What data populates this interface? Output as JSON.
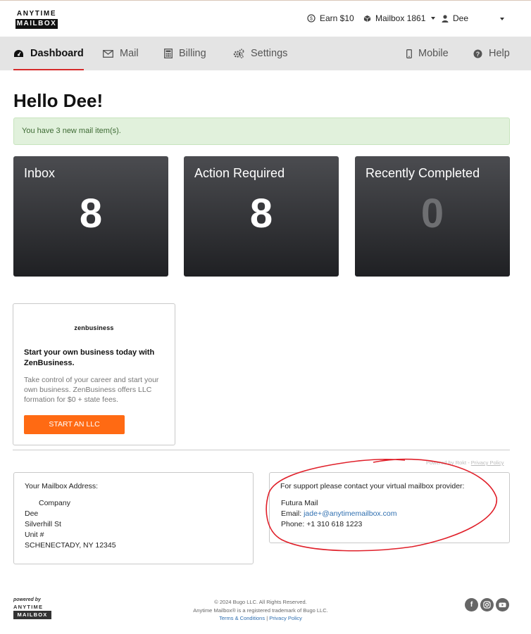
{
  "brand": {
    "line1": "ANYTIME",
    "line2": "MAILBOX"
  },
  "topbar": {
    "earn": "Earn $10",
    "mailbox": "Mailbox 1861",
    "user": "Dee"
  },
  "nav": {
    "dashboard": "Dashboard",
    "mail": "Mail",
    "billing": "Billing",
    "settings": "Settings",
    "mobile": "Mobile",
    "help": "Help"
  },
  "greeting": "Hello Dee!",
  "alert": "You have 3 new mail item(s).",
  "cards": [
    {
      "title": "Inbox",
      "count": "8"
    },
    {
      "title": "Action Required",
      "count": "8"
    },
    {
      "title": "Recently Completed",
      "count": "0"
    }
  ],
  "promo": {
    "brand": "zenbusiness",
    "headline": "Start your own business today with ZenBusiness.",
    "body": "Take control of your career and start your own business. ZenBusiness offers LLC formation for $0 + state fees.",
    "button": "START AN LLC"
  },
  "powered": {
    "text": "Powered by Rokt",
    "sep": " - ",
    "privacy": "Privacy Policy"
  },
  "address": {
    "label": "Your Mailbox Address:",
    "company": "Company",
    "name": "Dee",
    "street": "Silverhill St",
    "unit": "Unit #",
    "city": "SCHENECTADY, NY 12345"
  },
  "support": {
    "label": "For support please contact your virtual mailbox provider:",
    "provider": "Futura Mail",
    "email_label": "Email: ",
    "email": "jade+@anytimemailbox.com",
    "phone": "Phone: +1 310 618 1223"
  },
  "footer": {
    "powered_by": "powered by",
    "brand1": "ANYTIME",
    "brand2": "MAILBOX",
    "copyright": "© 2024 Bugo LLC. All Rights Reserved.",
    "trademark": "Anytime Mailbox® is a registered trademark of Bugo LLC.",
    "terms": "Terms & Conditions",
    "sep": " | ",
    "privacy": "Privacy Policy"
  },
  "colors": {
    "accent": "#d62b2b",
    "cta": "#ff6a13",
    "link": "#2f6fb0",
    "annotation": "#e0202a"
  }
}
